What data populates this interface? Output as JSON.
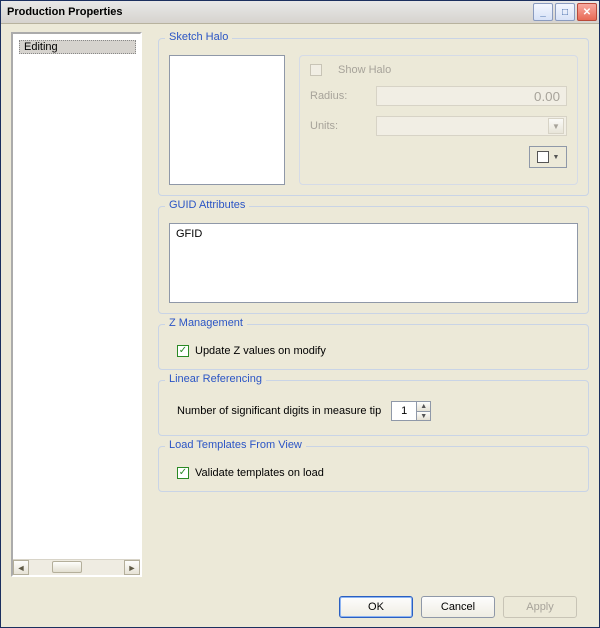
{
  "window": {
    "title": "Production Properties"
  },
  "tree": {
    "items": [
      "Editing"
    ]
  },
  "groups": {
    "sketch_halo": {
      "legend": "Sketch Halo",
      "show_halo_label": "Show Halo",
      "radius_label": "Radius:",
      "radius_value": "0.00",
      "units_label": "Units:",
      "units_value": ""
    },
    "guid": {
      "legend": "GUID Attributes",
      "items": [
        "GFID"
      ]
    },
    "zmgmt": {
      "legend": "Z Management",
      "update_label": "Update Z values on modify",
      "update_checked": true
    },
    "linref": {
      "legend": "Linear Referencing",
      "digits_label": "Number of significant digits in measure tip",
      "digits_value": "1"
    },
    "load": {
      "legend": "Load Templates From View",
      "validate_label": "Validate templates on load",
      "validate_checked": true
    }
  },
  "buttons": {
    "ok": "OK",
    "cancel": "Cancel",
    "apply": "Apply"
  }
}
